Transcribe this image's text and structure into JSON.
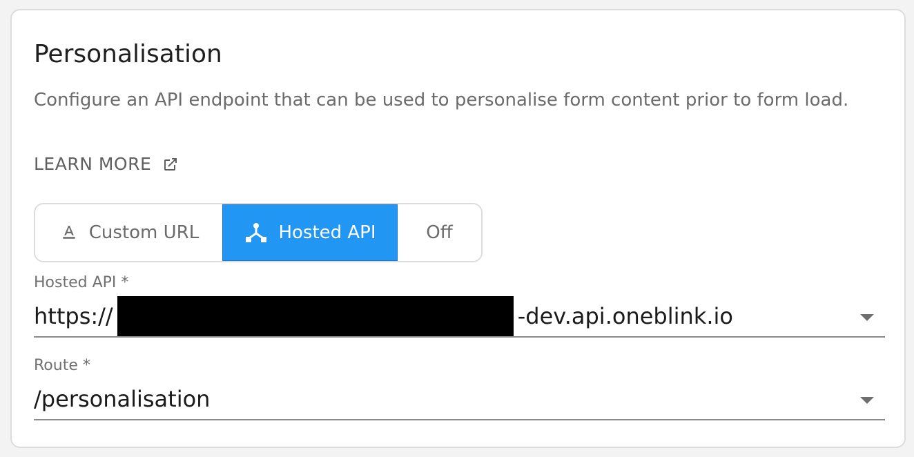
{
  "section": {
    "title": "Personalisation",
    "description": "Configure an API endpoint that can be used to personalise form content prior to form load.",
    "learn_more_label": "LEARN MORE"
  },
  "mode_toggle": {
    "options": [
      {
        "label": "Custom URL",
        "icon": "text-format-icon",
        "selected": false
      },
      {
        "label": "Hosted API",
        "icon": "api-icon",
        "selected": true
      },
      {
        "label": "Off",
        "icon": null,
        "selected": false
      }
    ]
  },
  "hosted_api_field": {
    "label": "Hosted API *",
    "value_prefix": "https://",
    "value_suffix": "-dev.api.oneblink.io"
  },
  "route_field": {
    "label": "Route *",
    "value": "/personalisation"
  },
  "colors": {
    "accent": "#2196f3",
    "text_primary": "#1f1f1f",
    "text_secondary": "#6b6b6b"
  }
}
